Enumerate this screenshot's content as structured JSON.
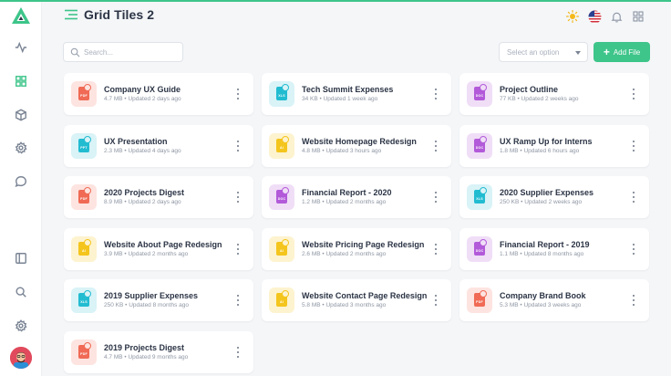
{
  "header": {
    "title": "Grid Tiles 2"
  },
  "toolbar": {
    "search_placeholder": "Search...",
    "select_placeholder": "Select an option",
    "add_label": "Add File"
  },
  "colors": {
    "accent": "#3ec58a"
  },
  "sidebar": {
    "items": [
      {
        "icon": "activity-icon"
      },
      {
        "icon": "grid-icon",
        "active": true
      },
      {
        "icon": "box-icon"
      },
      {
        "icon": "settings-icon"
      },
      {
        "icon": "chat-icon"
      },
      {
        "icon": "panel-icon"
      },
      {
        "icon": "search-icon"
      },
      {
        "icon": "gear-icon"
      }
    ]
  },
  "files": [
    {
      "title": "Company UX Guide",
      "size": "4.7 MB",
      "updated": "Updated 2 days ago",
      "type": "PDF"
    },
    {
      "title": "Tech Summit Expenses",
      "size": "34 KB",
      "updated": "Updated 1 week ago",
      "type": "XLS"
    },
    {
      "title": "Project Outline",
      "size": "77 KB",
      "updated": "Updated 2 weeks ago",
      "type": "DOC"
    },
    {
      "title": "UX Presentation",
      "size": "2.3 MB",
      "updated": "Updated 4 days ago",
      "type": "PPT"
    },
    {
      "title": "Website Homepage Redesign",
      "size": "4.8 MB",
      "updated": "Updated 3 hours ago",
      "type": "AI"
    },
    {
      "title": "UX Ramp Up for Interns",
      "size": "1.8 MB",
      "updated": "Updated 6 hours ago",
      "type": "DOC"
    },
    {
      "title": "2020 Projects Digest",
      "size": "8.9 MB",
      "updated": "Updated 2 days ago",
      "type": "PDF"
    },
    {
      "title": "Financial Report - 2020",
      "size": "1.2 MB",
      "updated": "Updated 2 months ago",
      "type": "DOC"
    },
    {
      "title": "2020 Supplier Expenses",
      "size": "250 KB",
      "updated": "Updated 2 weeks ago",
      "type": "XLS"
    },
    {
      "title": "Website About Page Redesign",
      "size": "3.9 MB",
      "updated": "Updated 2 months ago",
      "type": "AI"
    },
    {
      "title": "Website Pricing Page Redesign",
      "size": "2.6 MB",
      "updated": "Updated 2 months ago",
      "type": "AI"
    },
    {
      "title": "Financial Report - 2019",
      "size": "1.1 MB",
      "updated": "Updated 8 months ago",
      "type": "DOC"
    },
    {
      "title": "2019 Supplier Expenses",
      "size": "250 KB",
      "updated": "Updated 8 months ago",
      "type": "XLS"
    },
    {
      "title": "Website Contact Page Redesign",
      "size": "5.8 MB",
      "updated": "Updated 3 months ago",
      "type": "AI"
    },
    {
      "title": "Company Brand Book",
      "size": "5.3 MB",
      "updated": "Updated 3 weeks ago",
      "type": "PDF"
    },
    {
      "title": "2019 Projects Digest",
      "size": "4.7 MB",
      "updated": "Updated 9 months ago",
      "type": "PDF"
    }
  ],
  "file_type_colors": {
    "PDF": {
      "bg": "#fde4e0",
      "fg": "#f06a55"
    },
    "XLS": {
      "bg": "#d9f3f7",
      "fg": "#22bcd1"
    },
    "DOC": {
      "bg": "#f0def7",
      "fg": "#b25ad9"
    },
    "PPT": {
      "bg": "#d9f3f7",
      "fg": "#22bcd1"
    },
    "AI": {
      "bg": "#fdf3cf",
      "fg": "#f4c51c"
    }
  }
}
